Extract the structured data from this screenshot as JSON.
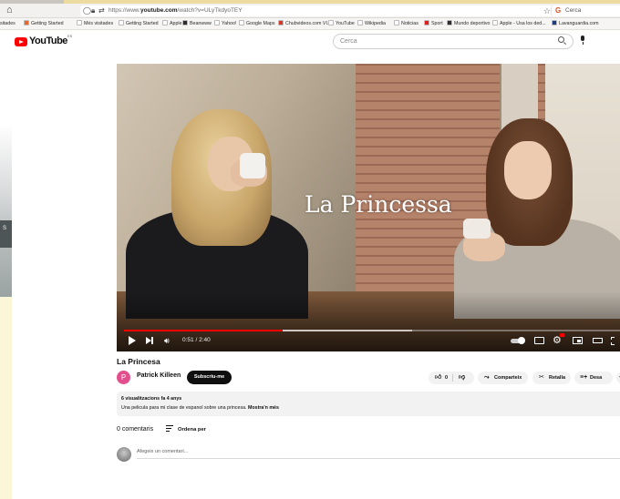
{
  "browser": {
    "url_prefix": "https://www.",
    "url_domain": "youtube.com",
    "url_path": "/watch?v=ULyTkdyoTEY",
    "search_placeholder": "Cerca",
    "bookmarks": [
      {
        "label": "sitades",
        "color": "#f2f1ef"
      },
      {
        "label": "Getting Started",
        "color": "#e8662f"
      },
      {
        "label": "Més visitades",
        "color": "#ffffff"
      },
      {
        "label": "Getting Started",
        "color": "#ffffff"
      },
      {
        "label": "Apple",
        "color": "#ffffff"
      },
      {
        "label": "Beanwww",
        "color": "#2c2c2c"
      },
      {
        "label": "Yahoo!",
        "color": "#ffffff"
      },
      {
        "label": "Google Maps",
        "color": "#ffffff"
      },
      {
        "label": "Chubvideos.com VI...",
        "color": "#d13a2a"
      },
      {
        "label": "YouTube",
        "color": "#ffffff"
      },
      {
        "label": "Wikipedia",
        "color": "#ffffff"
      },
      {
        "label": "Noticias",
        "color": "#ffffff"
      },
      {
        "label": "Sport",
        "color": "#e02020"
      },
      {
        "label": "Mundo deportivo",
        "color": "#2d2d2d"
      },
      {
        "label": "Apple - Usa los ded...",
        "color": "#ffffff"
      },
      {
        "label": "Lavanguardia.com",
        "color": "#1f3b7a"
      }
    ]
  },
  "youtube": {
    "logo_text": "YouTube",
    "logo_country": "ES",
    "search_placeholder": "Cerca"
  },
  "left_fragment": {
    "letter": "S"
  },
  "player": {
    "overlay_title": "La Princessa",
    "time": "0:51 / 2:40",
    "progress": 0.32,
    "buffered": 0.58,
    "hd_badge_color": "#ff0000"
  },
  "video": {
    "title": "La Princesa",
    "channel": "Patrick Killeen",
    "avatar_letter": "P",
    "avatar_color": "#e34e8c",
    "subscribe_label": "Subscriu-me",
    "likes": "0",
    "share_label": "Comparteix",
    "clip_label": "Retalla",
    "save_label": "Desa"
  },
  "description": {
    "meta": "6 visualitzacions  fa 4 anys",
    "text": "Una pelicula para mi clase de espanol sobre una princesa.",
    "more_label": "Mostra'n més"
  },
  "comments": {
    "count_label": "0 comentaris",
    "sort_label": "Ordena per",
    "add_placeholder": "Afegeix un comentari..."
  }
}
